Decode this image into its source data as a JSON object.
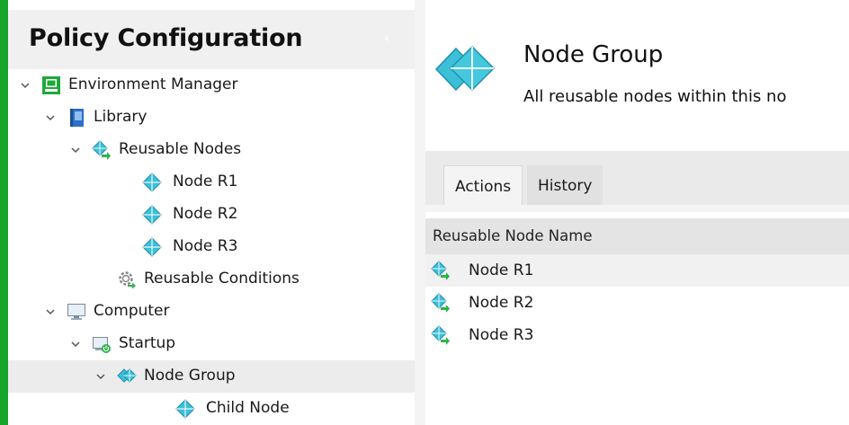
{
  "app": {
    "accent_color": "#16a52a",
    "panel_title": "Policy Configuration",
    "collapse_glyph": "‹"
  },
  "tree": {
    "items": [
      {
        "label": "Environment Manager",
        "icon": "environment-manager-icon"
      },
      {
        "label": "Library",
        "icon": "library-book-icon"
      },
      {
        "label": "Reusable Nodes",
        "icon": "reusable-nodes-icon"
      },
      {
        "label": "Node R1",
        "icon": "node-diamond-icon"
      },
      {
        "label": "Node R2",
        "icon": "node-diamond-icon"
      },
      {
        "label": "Node R3",
        "icon": "node-diamond-icon"
      },
      {
        "label": "Reusable Conditions",
        "icon": "reusable-conditions-gear-icon"
      },
      {
        "label": "Computer",
        "icon": "computer-monitor-icon"
      },
      {
        "label": "Startup",
        "icon": "startup-icon"
      },
      {
        "label": "Node Group",
        "icon": "node-group-icon"
      },
      {
        "label": "Child Node",
        "icon": "node-diamond-icon"
      }
    ],
    "selected": "Node Group"
  },
  "detail": {
    "title": "Node Group",
    "description": "All reusable nodes within this no",
    "icon": "node-group-large-icon"
  },
  "tabs": [
    {
      "label": "Actions",
      "active": true
    },
    {
      "label": "History",
      "active": false
    }
  ],
  "list": {
    "column_header": "Reusable Node Name",
    "rows": [
      {
        "label": "Node R1",
        "icon": "reusable-node-icon"
      },
      {
        "label": "Node R2",
        "icon": "reusable-node-icon"
      },
      {
        "label": "Node R3",
        "icon": "reusable-node-icon"
      }
    ]
  },
  "colors": {
    "node_blue": "#3cc0d8",
    "arrow_green": "#2bb24c",
    "book_blue": "#2d6fc4"
  }
}
